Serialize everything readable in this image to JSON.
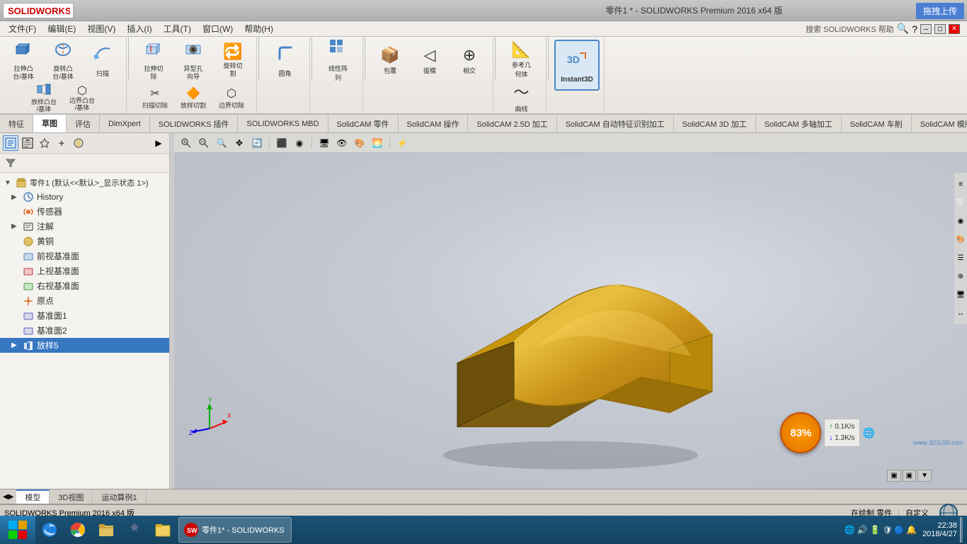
{
  "app": {
    "title": "零件1 * - SOLIDWORKS Premium 2016 x64 版",
    "logo": "SOLIDWORKS"
  },
  "menu": {
    "items": [
      "文件(F)",
      "编辑(E)",
      "视图(V)",
      "插入(I)",
      "工具(T)",
      "窗口(W)",
      "帮助(H)"
    ]
  },
  "ribbon": {
    "tabs": [
      "特征",
      "草图",
      "评估",
      "DimXpert",
      "SOLIDWORKS 插件",
      "SOLIDWORKS MBD",
      "SolidCAM 零件",
      "SolidCAM 操作",
      "SolidCAM 2.5D 加工",
      "SolidCAM 自动特征识别加工",
      "SolidCAM 3D 加工",
      "SolidCAM 多轴加工",
      "SolidCAM 车削",
      "SolidCAM 模版"
    ],
    "active_tab": "草图",
    "buttons": [
      {
        "label": "拉伸凸\n台/基体",
        "icon": "📦"
      },
      {
        "label": "旋转凸\n台/基体",
        "icon": "🔄"
      },
      {
        "label": "扫描",
        "icon": "↗"
      },
      {
        "label": "放样凸台/基体",
        "icon": "🔷"
      },
      {
        "label": "边界凸台/基体",
        "icon": "⬡"
      },
      {
        "label": "拉伸切\n除",
        "icon": "✂"
      },
      {
        "label": "异型孔\n向导",
        "icon": "🕳"
      },
      {
        "label": "旋转切\n割",
        "icon": "🔁"
      },
      {
        "label": "扫描切除",
        "icon": "↗"
      },
      {
        "label": "放样切割",
        "icon": "🔶"
      },
      {
        "label": "边界切除",
        "icon": "⬡"
      },
      {
        "label": "圆角",
        "icon": "⌒"
      },
      {
        "label": "线性阵\n列",
        "icon": "▦"
      },
      {
        "label": "包覆",
        "icon": "🔲"
      },
      {
        "label": "拔模",
        "icon": "◁"
      },
      {
        "label": "相交",
        "icon": "⊕"
      },
      {
        "label": "参考几\n何体",
        "icon": "📐"
      },
      {
        "label": "曲线",
        "icon": "〜"
      },
      {
        "label": "Instant3D",
        "icon": "3D"
      }
    ]
  },
  "left_panel": {
    "title": "零件1 (默认<<默认>_显示状态 1>)",
    "toolbar_buttons": [
      {
        "icon": "🔍",
        "label": "feature-manager"
      },
      {
        "icon": "⊞",
        "label": "property-manager"
      },
      {
        "icon": "🗂",
        "label": "config-manager"
      },
      {
        "icon": "+",
        "label": "add-manager"
      },
      {
        "icon": "🎨",
        "label": "appearance-manager"
      },
      {
        "icon": "▶",
        "label": "expand"
      }
    ],
    "tree_items": [
      {
        "level": 0,
        "icon": "📋",
        "label": "零件1 (默认<<默认>_显示状态 1>)",
        "has_arrow": false
      },
      {
        "level": 1,
        "icon": "📜",
        "label": "History",
        "has_arrow": true
      },
      {
        "level": 1,
        "icon": "📡",
        "label": "传感器",
        "has_arrow": false
      },
      {
        "level": 1,
        "icon": "📝",
        "label": "注解",
        "has_arrow": true
      },
      {
        "level": 1,
        "icon": "🔩",
        "label": "黄铜",
        "has_arrow": false
      },
      {
        "level": 1,
        "icon": "📐",
        "label": "前视基准面",
        "has_arrow": false
      },
      {
        "level": 1,
        "icon": "📐",
        "label": "上视基准面",
        "has_arrow": false
      },
      {
        "level": 1,
        "icon": "📐",
        "label": "右视基准面",
        "has_arrow": false
      },
      {
        "level": 1,
        "icon": "✚",
        "label": "原点",
        "has_arrow": false
      },
      {
        "level": 1,
        "icon": "📄",
        "label": "基准面1",
        "has_arrow": false
      },
      {
        "level": 1,
        "icon": "📄",
        "label": "基准面2",
        "has_arrow": false
      },
      {
        "level": 1,
        "icon": "⭐",
        "label": "放样5",
        "has_arrow": true,
        "highlighted": true
      }
    ]
  },
  "viewport": {
    "toolbar_icons": [
      "🔍",
      "🔍",
      "↖",
      "⬜",
      "📷",
      "🔄",
      "💡",
      "🌐",
      "🎨",
      "🖥",
      "⚙"
    ]
  },
  "bottom_tabs": [
    "模型",
    "3D视图",
    "运动算例1"
  ],
  "status_bar": {
    "left": "SOLIDWORKS Premium 2016 x64 版",
    "right_items": [
      "在绘制 零件",
      "自定义"
    ]
  },
  "net_indicator": {
    "percent": "83%",
    "upload_speed": "0.1K/s",
    "download_speed": "1.3K/s"
  },
  "upload_btn": "拖拽上传",
  "taskbar": {
    "icons": [
      "⊞",
      "🌐",
      "📁",
      "🖥",
      "📁",
      "⚙"
    ],
    "sw_label": "SW",
    "clock": "22:38",
    "date": "2018/4/27",
    "watermark": "www.3DSJW.com"
  },
  "display_controls": [
    "▣",
    "▣",
    "▼"
  ]
}
